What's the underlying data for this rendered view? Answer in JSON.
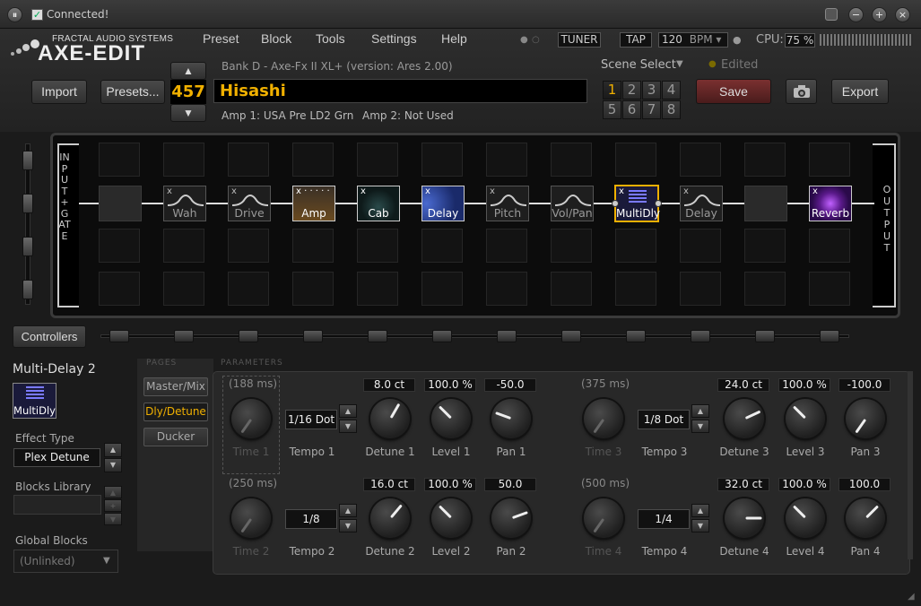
{
  "titlebar": {
    "connected_label": "Connected!"
  },
  "logo": {
    "brand": "FRACTAL AUDIO SYSTEMS",
    "product": "AXE-EDIT"
  },
  "menu": [
    "Preset",
    "Block",
    "Tools",
    "Settings",
    "Help"
  ],
  "toolbar": {
    "tuner": "TUNER",
    "tap": "TAP",
    "bpm_value": "120",
    "bpm_unit": "BPM",
    "cpu_label": "CPU:",
    "cpu_value": "75 %"
  },
  "preset": {
    "import_label": "Import",
    "presets_label": "Presets...",
    "number": "457",
    "bank_info": "Bank D - Axe-Fx II XL+ (version: Ares 2.00)",
    "name": "Hisashi",
    "amp1": "Amp 1: USA Pre LD2 Grn",
    "amp2": "Amp 2: Not Used"
  },
  "scene": {
    "label": "Scene Select",
    "edited": "Edited",
    "buttons": [
      "1",
      "2",
      "3",
      "4",
      "5",
      "6",
      "7",
      "8"
    ],
    "active": "1"
  },
  "actions": {
    "save": "Save",
    "export": "Export"
  },
  "grid": {
    "input_label": "INPUT + GATE",
    "output_label": "OUTPUT",
    "blocks": [
      "Wah",
      "Drive",
      "Amp",
      "Cab",
      "Delay",
      "Pitch",
      "Vol/Pan",
      "MultiDly",
      "Delay",
      "Reverb"
    ]
  },
  "controllers": {
    "label": "Controllers"
  },
  "block_panel": {
    "title": "Multi-Delay 2",
    "icon_label": "MultiDly",
    "effect_type_label": "Effect Type",
    "effect_type_value": "Plex Detune",
    "library_label": "Blocks Library",
    "global_label": "Global Blocks",
    "global_value": "(Unlinked)"
  },
  "pages": {
    "header": "PAGES",
    "items": [
      "Master/Mix",
      "Dly/Detune",
      "Ducker"
    ],
    "active": "Dly/Detune"
  },
  "params": {
    "header": "PARAMETERS",
    "row1": [
      {
        "top": "(188 ms)",
        "label": "Time 1"
      },
      {
        "top": "1/16 Dot",
        "label": "Tempo 1"
      },
      {
        "top": "8.0 ct",
        "label": "Detune 1"
      },
      {
        "top": "100.0 %",
        "label": "Level 1"
      },
      {
        "top": "-50.0",
        "label": "Pan 1"
      },
      {
        "top": "(375 ms)",
        "label": "Time 3"
      },
      {
        "top": "1/8 Dot",
        "label": "Tempo 3"
      },
      {
        "top": "24.0 ct",
        "label": "Detune 3"
      },
      {
        "top": "100.0 %",
        "label": "Level 3"
      },
      {
        "top": "-100.0",
        "label": "Pan 3"
      }
    ],
    "row2": [
      {
        "top": "(250 ms)",
        "label": "Time 2"
      },
      {
        "top": "1/8",
        "label": "Tempo 2"
      },
      {
        "top": "16.0 ct",
        "label": "Detune 2"
      },
      {
        "top": "100.0 %",
        "label": "Level 2"
      },
      {
        "top": "50.0",
        "label": "Pan 2"
      },
      {
        "top": "(500 ms)",
        "label": "Time 4"
      },
      {
        "top": "1/4",
        "label": "Tempo 4"
      },
      {
        "top": "32.0 ct",
        "label": "Detune 4"
      },
      {
        "top": "100.0 %",
        "label": "Level 4"
      },
      {
        "top": "100.0",
        "label": "Pan 4"
      }
    ]
  },
  "colors": {
    "accent_yellow": "#f0b000",
    "save_red": "#6a2a2a"
  }
}
